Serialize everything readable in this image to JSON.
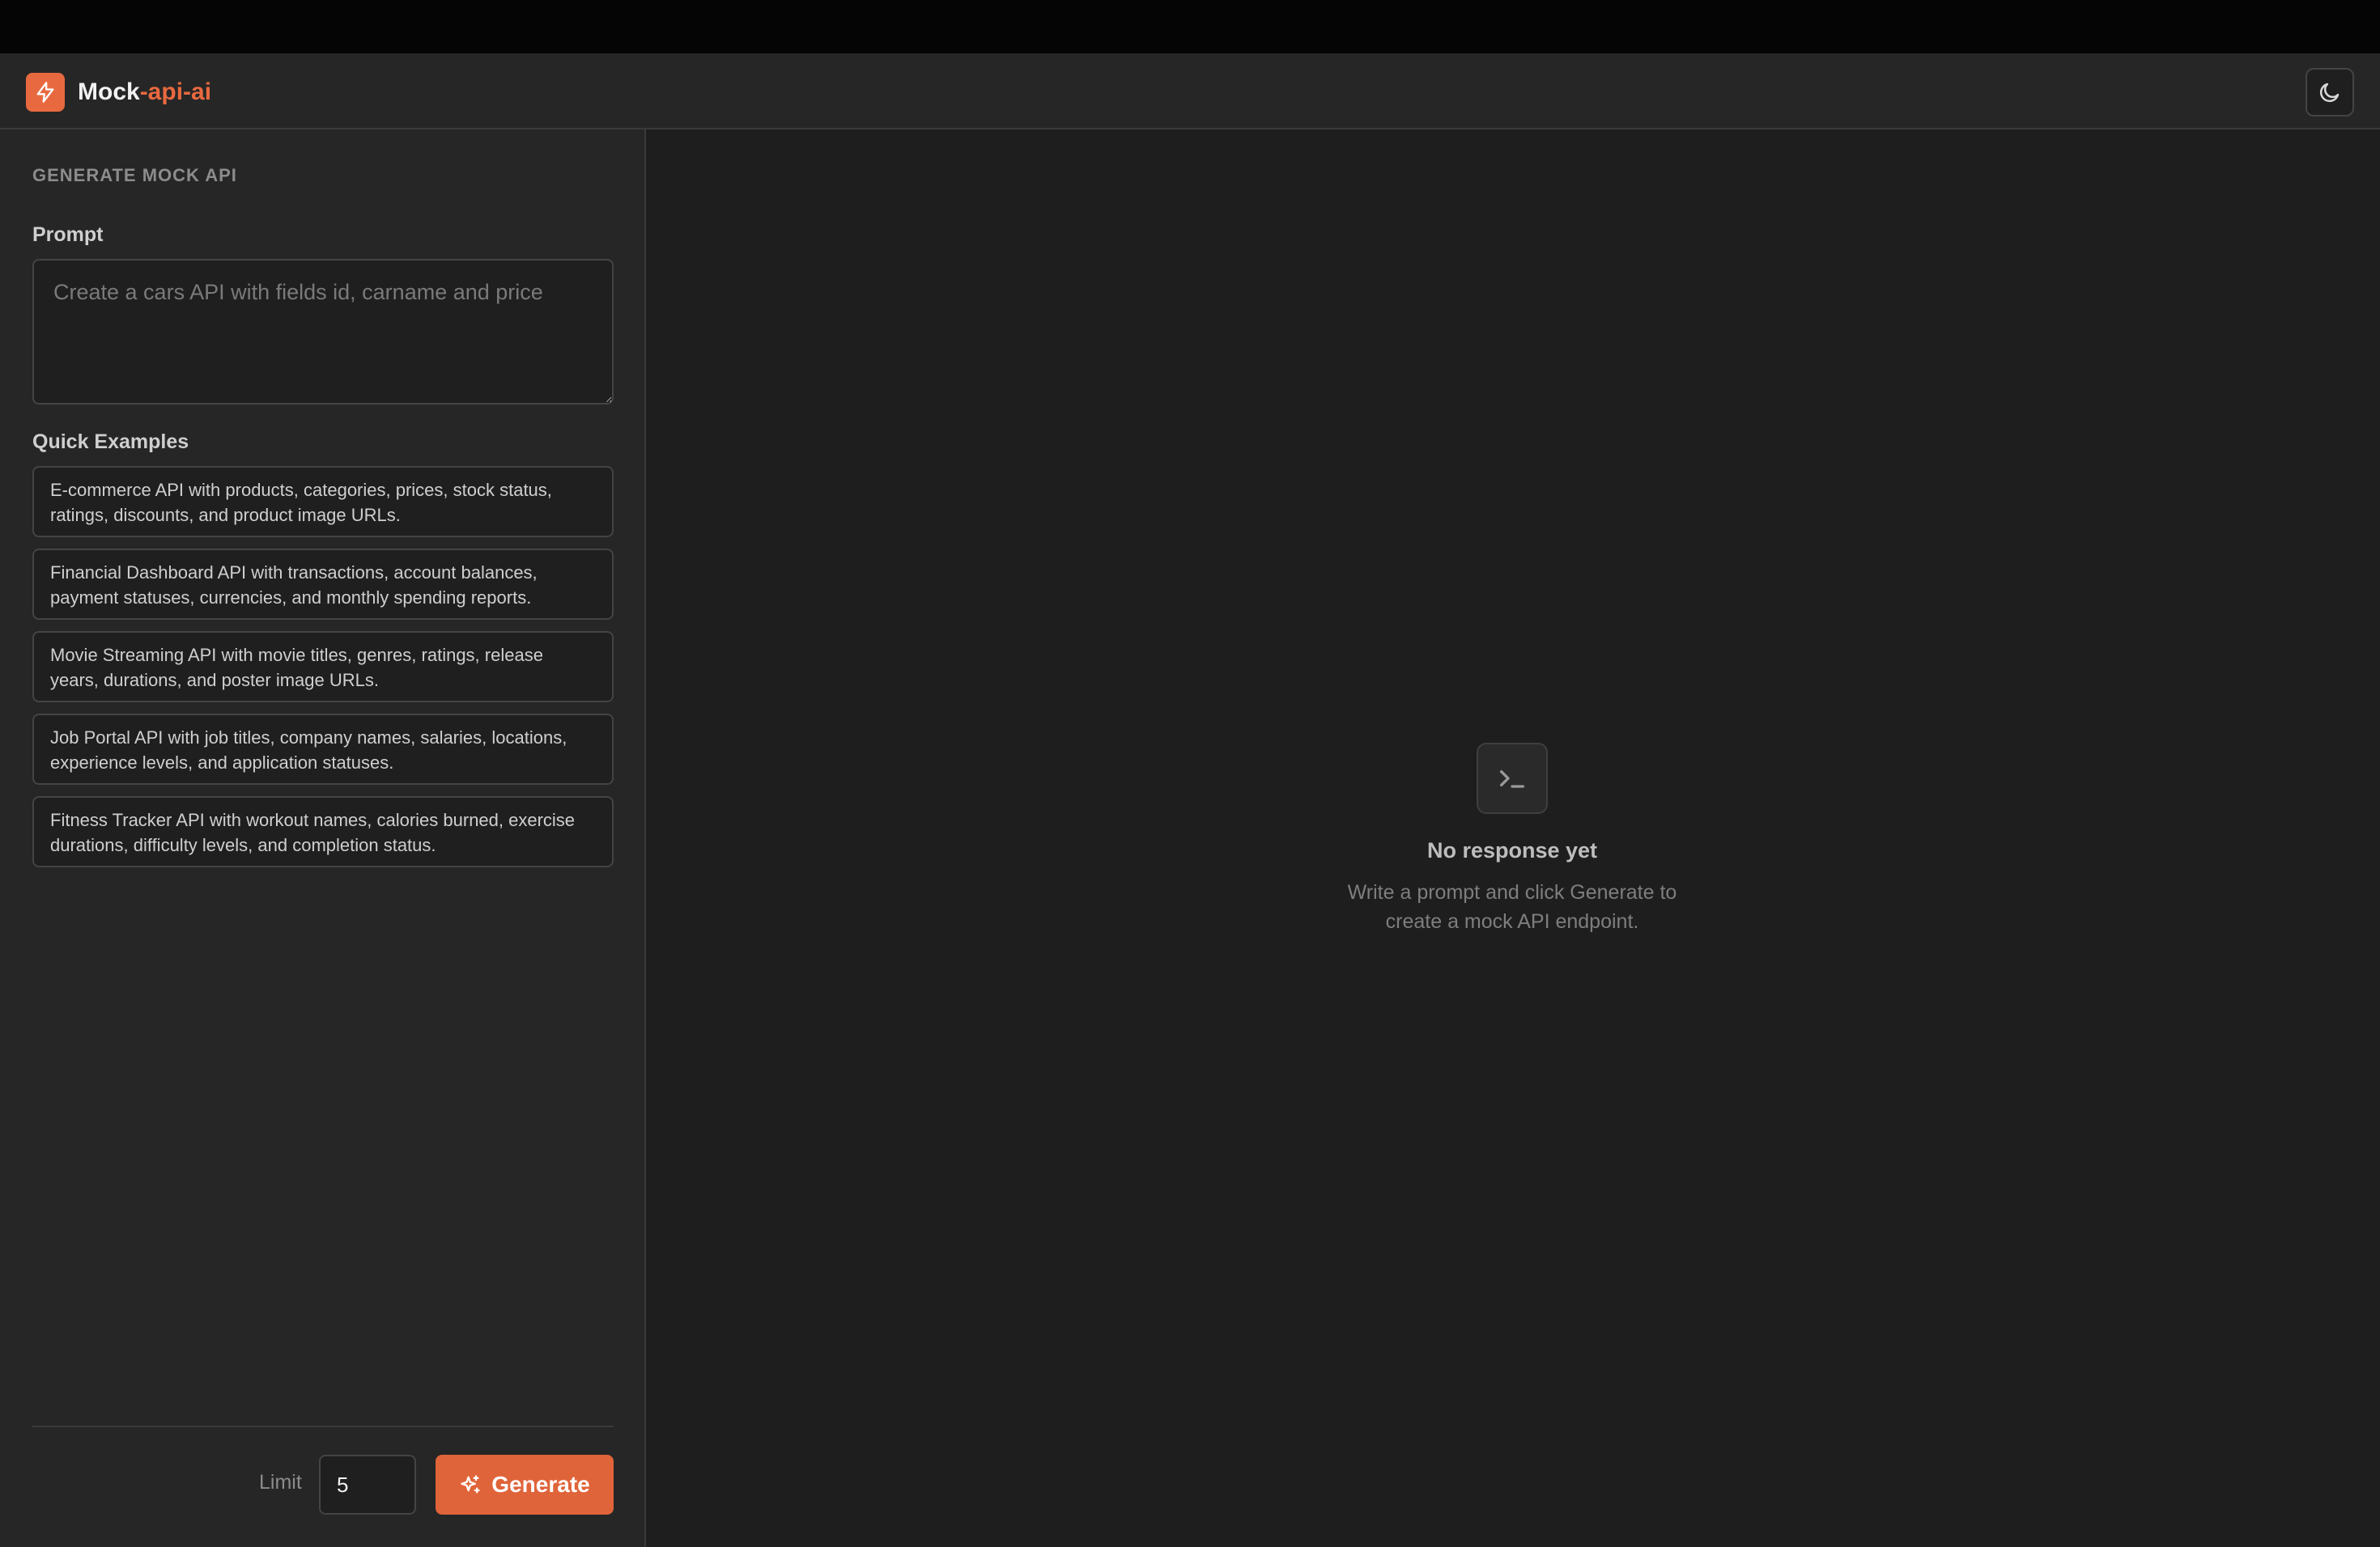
{
  "app": {
    "title_main": "Mock",
    "title_accent": "-api-ai",
    "accent_color": "#e8693f"
  },
  "header": {
    "logo_icon": "lightning-bolt-icon",
    "theme_toggle_icon": "moon-icon"
  },
  "sidebar": {
    "section_title": "GENERATE MOCK API",
    "prompt_label": "Prompt",
    "prompt_placeholder": "Create a cars API with fields id, carname and price",
    "prompt_value": "",
    "examples_label": "Quick Examples",
    "examples": [
      "E-commerce API with products, categories, prices, stock status, ratings, discounts, and product image URLs.",
      "Financial Dashboard API with transactions, account balances, payment statuses, currencies, and monthly spending reports.",
      "Movie Streaming API with movie titles, genres, ratings, release years, durations, and poster image URLs.",
      "Job Portal API with job titles, company names, salaries, locations, experience levels, and application statuses.",
      "Fitness Tracker API with workout names, calories burned, exercise durations, difficulty levels, and completion status."
    ],
    "limit_label": "Limit",
    "limit_value": "5",
    "generate_label": "Generate",
    "generate_icon": "sparkles-icon"
  },
  "main": {
    "empty_icon": "terminal-icon",
    "empty_title": "No response yet",
    "empty_subtitle": "Write a prompt and click Generate to create a mock API endpoint."
  }
}
